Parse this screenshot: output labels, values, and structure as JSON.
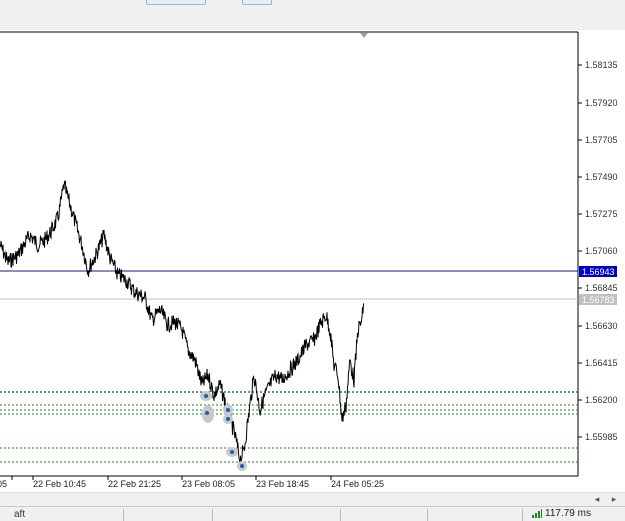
{
  "chart": {
    "price_axis": [
      "1.58135",
      "1.57920",
      "1.57705",
      "1.57490",
      "1.57275",
      "1.57060",
      "1.56845",
      "1.56630",
      "1.56415",
      "1.56200",
      "1.55985"
    ],
    "bid_label": "1.56943",
    "ask_label": "1.56783",
    "time_axis": [
      "05",
      "22 Feb 10:45",
      "22 Feb 21:25",
      "23 Feb 08:05",
      "23 Feb 18:45",
      "24 Feb 05:25"
    ],
    "colors": {
      "bid_line": "#1a1a80",
      "bid_label_bg": "#0000cc",
      "ask_line": "#c0c0c0",
      "ask_label_bg": "#c0c0c0",
      "level_line": "#1a8a1a",
      "price_line": "#000000",
      "marker": "#1a5fb4"
    }
  },
  "scrollbar": {
    "left": "◂",
    "right": "▸"
  },
  "status_bar": {
    "left_text": "aft",
    "connection": "117.79 ms"
  }
}
